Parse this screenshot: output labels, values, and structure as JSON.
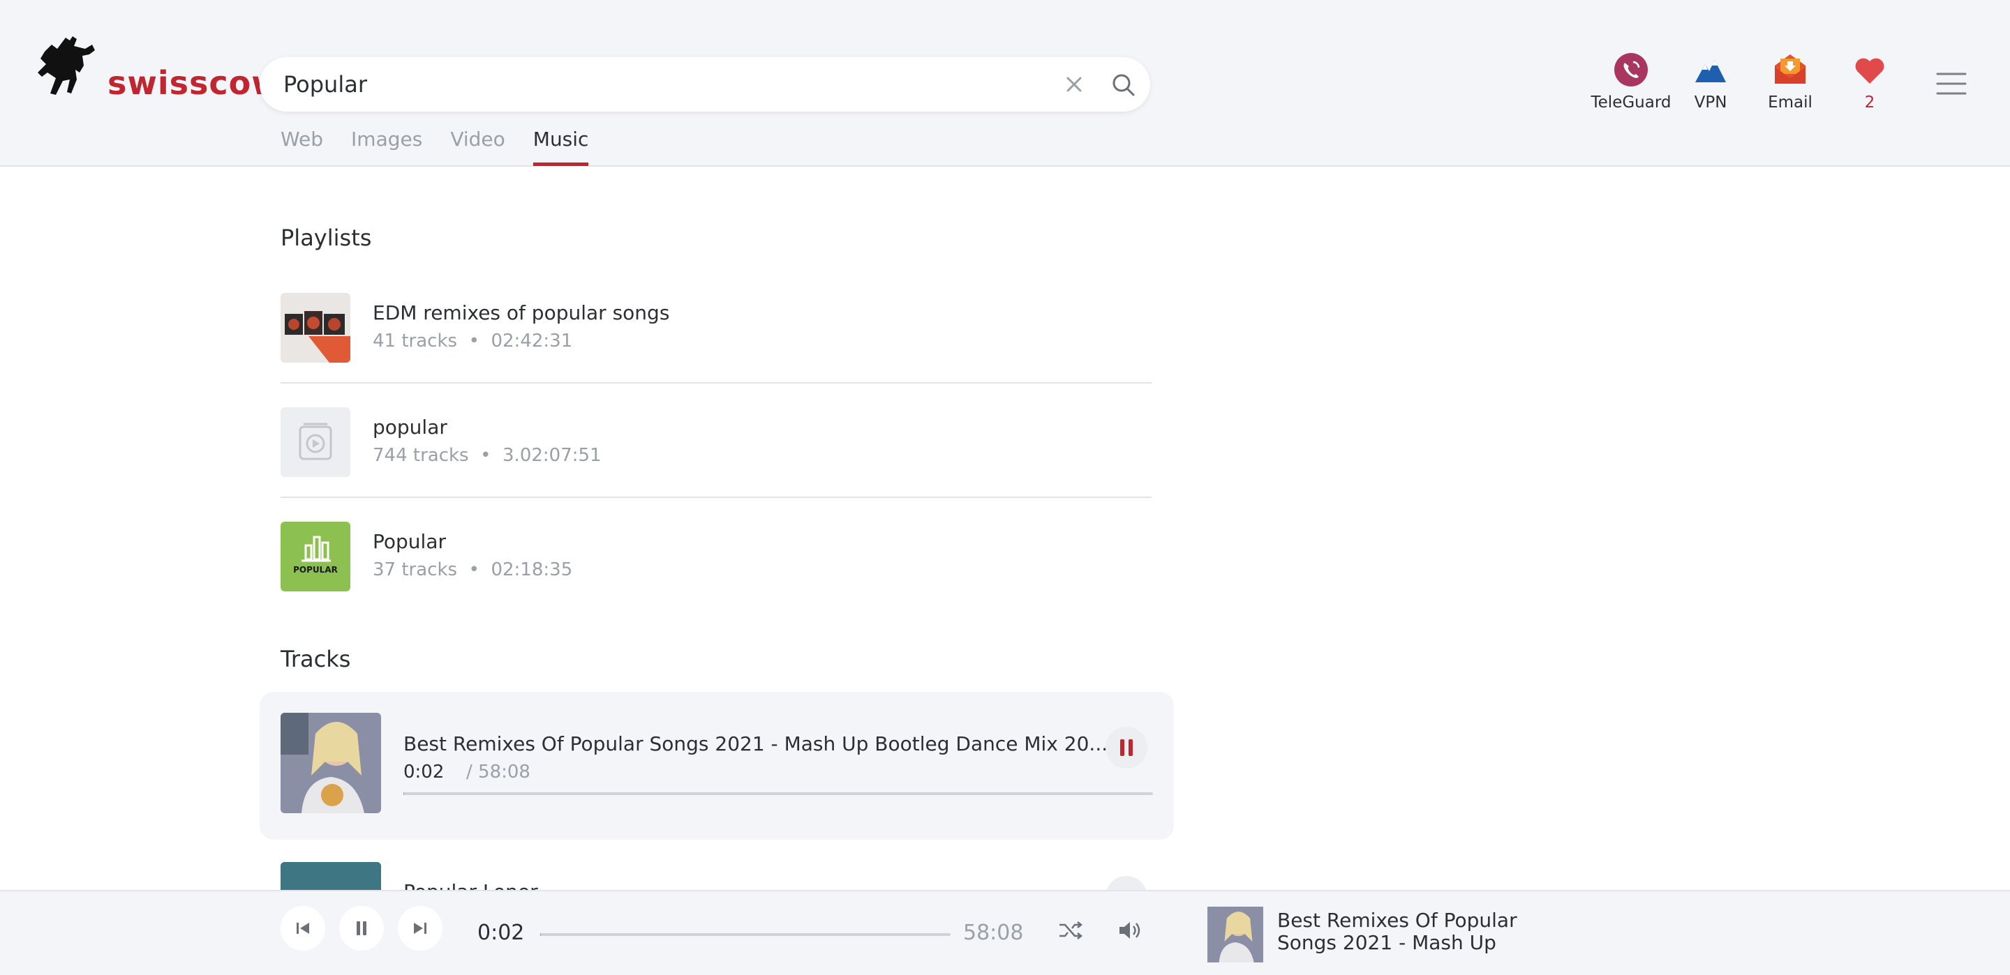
{
  "brand": {
    "name": "swisscows"
  },
  "search": {
    "query": "Popular"
  },
  "tabs": [
    {
      "label": "Web"
    },
    {
      "label": "Images"
    },
    {
      "label": "Video"
    },
    {
      "label": "Music",
      "active": true
    }
  ],
  "header_links": [
    {
      "label": "TeleGuard",
      "icon": "teleguard-icon"
    },
    {
      "label": "VPN",
      "icon": "vpn-icon"
    },
    {
      "label": "Email",
      "icon": "email-icon"
    },
    {
      "label": "2",
      "icon": "heart-icon"
    }
  ],
  "playlists": {
    "title": "Playlists",
    "items": [
      {
        "name": "EDM remixes of popular songs",
        "tracks": "41 tracks",
        "duration": "02:42:31",
        "thumb": "edm-cover"
      },
      {
        "name": "popular",
        "tracks": "744 tracks",
        "duration": "3.02:07:51",
        "thumb": "placeholder-cover"
      },
      {
        "name": "Popular",
        "tracks": "37 tracks",
        "duration": "02:18:35",
        "thumb": "popular-cover",
        "thumb_text": "POPULAR"
      }
    ]
  },
  "tracks": {
    "title": "Tracks",
    "items": [
      {
        "title": "Best Remixes Of Popular Songs 2021 - Mash Up Bootleg Dance Mix 20...",
        "current": "0:02",
        "duration": "/ 58:08",
        "progress": 0.001,
        "playing": true
      },
      {
        "title": "Popular Loner",
        "playing": false
      }
    ]
  },
  "player": {
    "current": "0:02",
    "duration": "58:08",
    "progress": 0.001,
    "now_playing": "Best Remixes Of Popular Songs 2021 - Mash Up"
  },
  "colors": {
    "accent": "#c0262f",
    "background": "#f4f5f8",
    "muted": "#9aa0a8"
  }
}
